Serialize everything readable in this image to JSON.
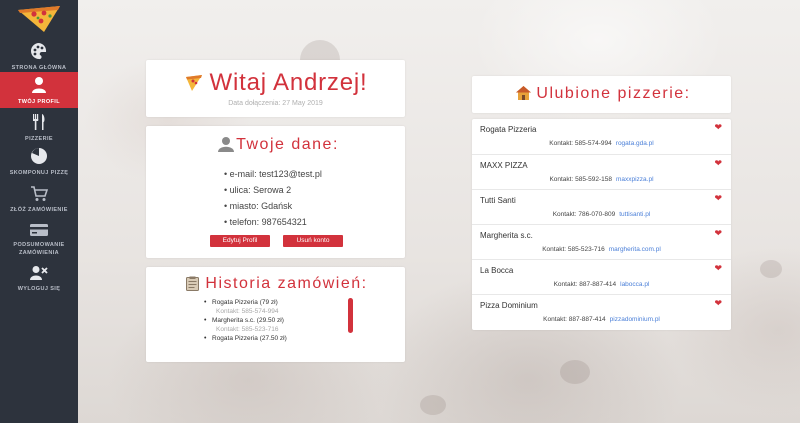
{
  "sidebar": {
    "items": [
      {
        "label": "STRONA GŁÓWNA",
        "icon": "palette-icon"
      },
      {
        "label": "TWÓJ PROFIL",
        "icon": "user-icon",
        "active": true
      },
      {
        "label": "PIZZERIE",
        "icon": "cutlery-icon"
      },
      {
        "label": "SKOMPONUJ PIZZĘ",
        "icon": "pie-chart-icon"
      },
      {
        "label": "ZŁÓŻ ZAMÓWIENIE",
        "icon": "cart-icon"
      },
      {
        "label": "PODSUMOWANIE",
        "label2": "ZAMÓWIENIA",
        "icon": "credit-card-icon"
      },
      {
        "label": "WYLOGUJ SIĘ",
        "icon": "user-remove-icon"
      }
    ]
  },
  "welcome": {
    "title": "Witaj Andrzej!",
    "joined": "Data dołączenia: 27 May 2019"
  },
  "user_data": {
    "title": "Twoje dane:",
    "fields": [
      "e-mail: test123@test.pl",
      "ulica: Serowa 2",
      "miasto: Gdańsk",
      "telefon: 987654321"
    ],
    "edit_label": "Edytuj Profil",
    "delete_label": "Usuń konto"
  },
  "history": {
    "title": "Historia zamówień:",
    "orders": [
      {
        "text": "Rogata Pizzeria (79 zł)",
        "contact": "Kontakt: 585-574-994"
      },
      {
        "text": "Margherita s.c. (29.50 zł)",
        "contact": "Kontakt: 585-523-716"
      },
      {
        "text": "Rogata Pizzeria (27.50 zł)",
        "contact": ""
      }
    ]
  },
  "favorites": {
    "title": "Ulubione pizzerie:",
    "items": [
      {
        "name": "Rogata Pizzeria",
        "contact": "Kontakt: 585-574-994",
        "url": "rogata.gda.pl"
      },
      {
        "name": "MAXX PIZZA",
        "contact": "Kontakt: 585-592-158",
        "url": "maxxpizza.pl"
      },
      {
        "name": "Tutti Santi",
        "contact": "Kontakt: 786-070-809",
        "url": "tuttisanti.pl"
      },
      {
        "name": "Margherita s.c.",
        "contact": "Kontakt: 585-523-716",
        "url": "margherita.com.pl"
      },
      {
        "name": "La Bocca",
        "contact": "Kontakt: 887-887-414",
        "url": "labocca.pl"
      },
      {
        "name": "Pizza Dominium",
        "contact": "Kontakt: 887-887-414",
        "url": "pizzadominium.pl"
      }
    ]
  },
  "colors": {
    "accent": "#d2323c",
    "sidebar": "#2d333d",
    "link": "#4a7fd8"
  }
}
